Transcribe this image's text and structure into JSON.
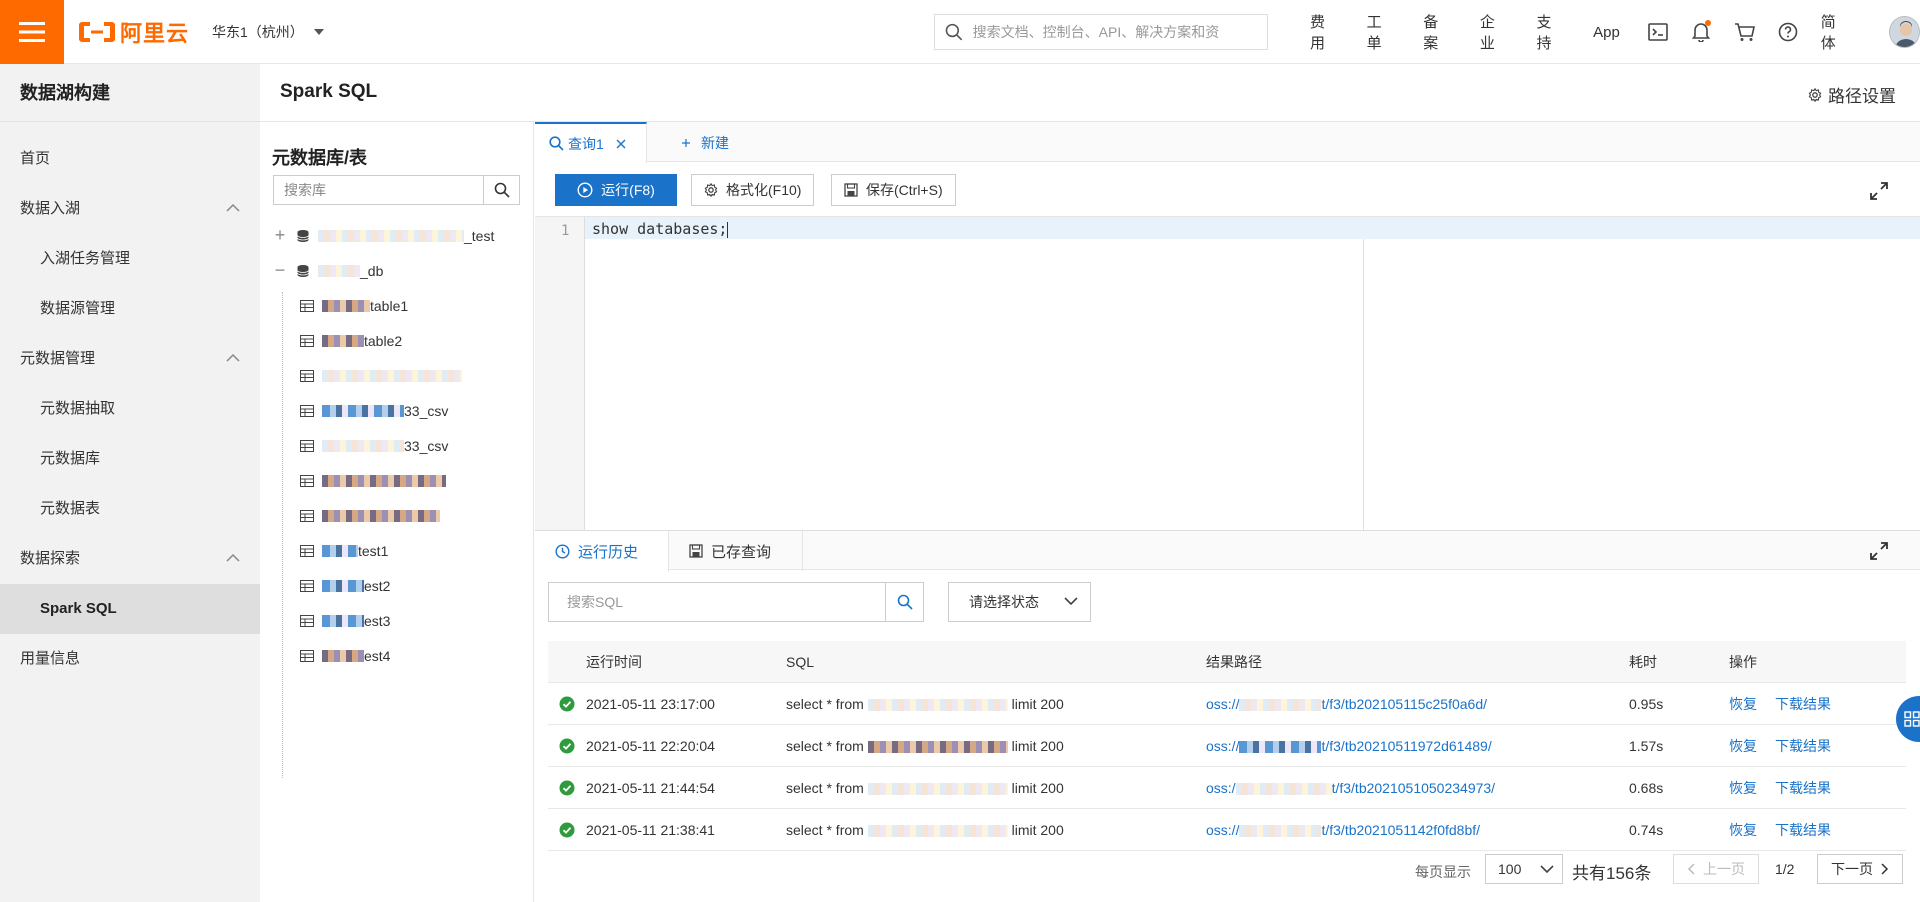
{
  "topbar": {
    "logo_text": "阿里云",
    "region": "华东1（杭州）",
    "search_placeholder": "搜索文档、控制台、API、解决方案和资",
    "nav_links": [
      "费用",
      "工单",
      "备案",
      "企业",
      "支持",
      "App"
    ],
    "lang": "简体",
    "brand_color": "#ff6a00"
  },
  "sidebar": {
    "title": "数据湖构建",
    "items": [
      {
        "label": "首页"
      },
      {
        "label": "数据入湖"
      },
      {
        "label": "入湖任务管理"
      },
      {
        "label": "数据源管理"
      },
      {
        "label": "元数据管理"
      },
      {
        "label": "元数据抽取"
      },
      {
        "label": "元数据库"
      },
      {
        "label": "元数据表"
      },
      {
        "label": "数据探索"
      },
      {
        "label": "Spark SQL"
      },
      {
        "label": "用量信息"
      }
    ]
  },
  "page": {
    "title": "Spark SQL",
    "path_settings": "路径设置"
  },
  "tree": {
    "title": "元数据库/表",
    "search_placeholder": "搜索库",
    "nodes": [
      {
        "suffix": "_test"
      },
      {
        "suffix": "_db"
      },
      {
        "suffix": "table1"
      },
      {
        "suffix": "table2"
      },
      {
        "suffix": ""
      },
      {
        "suffix": "33_csv"
      },
      {
        "suffix": "33_csv"
      },
      {
        "suffix": ""
      },
      {
        "suffix": ""
      },
      {
        "suffix": "test1"
      },
      {
        "suffix": "est2"
      },
      {
        "suffix": "est3"
      },
      {
        "suffix": "est4"
      }
    ]
  },
  "editor": {
    "tab_label": "查询1",
    "new_tab": "新建",
    "run": "运行(F8)",
    "format": "格式化(F10)",
    "save": "保存(Ctrl+S)",
    "line_number": "1",
    "code": "show databases;"
  },
  "history": {
    "tab_history": "运行历史",
    "tab_saved": "已存查询",
    "search_placeholder": "搜索SQL",
    "status_placeholder": "请选择状态",
    "columns": [
      "运行时间",
      "SQL",
      "结果路径",
      "耗时",
      "操作"
    ],
    "rows": [
      {
        "time": "2021-05-11 23:17:00",
        "sql_prefix": "select * from",
        "sql_suffix": "limit 200",
        "path_prefix": "oss://",
        "path_suffix": "t/f3/tb202105115c25f0a6d/",
        "duration": "0.95s",
        "restore": "恢复",
        "download": "下载结果"
      },
      {
        "time": "2021-05-11 22:20:04",
        "sql_prefix": "select * from",
        "sql_suffix": "limit 200",
        "path_prefix": "oss://",
        "path_suffix": "t/f3/tb20210511972d61489/",
        "duration": "1.57s",
        "restore": "恢复",
        "download": "下载结果"
      },
      {
        "time": "2021-05-11 21:44:54",
        "sql_prefix": "select * from",
        "sql_suffix": "limit 200",
        "path_prefix": "oss:/",
        "path_suffix": "t/f3/tb2021051050234973/",
        "duration": "0.68s",
        "restore": "恢复",
        "download": "下载结果"
      },
      {
        "time": "2021-05-11 21:38:41",
        "sql_prefix": "select * from",
        "sql_suffix": "limit 200",
        "path_prefix": "oss://",
        "path_suffix": "t/f3/tb2021051142f0fd8bf/",
        "duration": "0.74s",
        "restore": "恢复",
        "download": "下载结果"
      }
    ]
  },
  "pagination": {
    "per_page_label": "每页显示",
    "per_page": "100",
    "total": "共有156条",
    "prev": "上一页",
    "page": "1/2",
    "next": "下一页"
  }
}
